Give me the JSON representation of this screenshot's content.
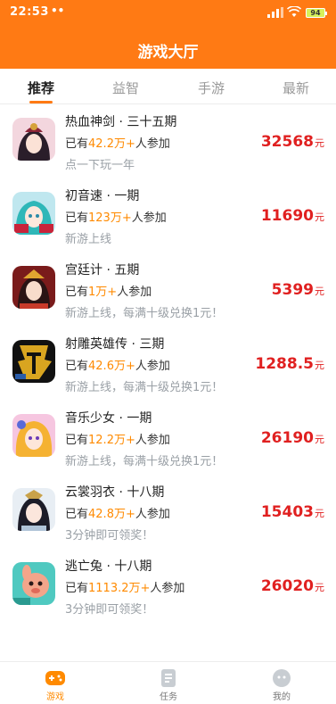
{
  "status_bar": {
    "time": "22:53",
    "dots": "••",
    "battery": "94"
  },
  "header": {
    "title": "游戏大厅"
  },
  "tabs": [
    {
      "label": "推荐",
      "active": true
    },
    {
      "label": "益智",
      "active": false
    },
    {
      "label": "手游",
      "active": false
    },
    {
      "label": "最新",
      "active": false
    }
  ],
  "games": [
    {
      "name": "热血神剑 · 三十五期",
      "players_prefix": "已有",
      "players_count": "42.2万+",
      "players_suffix": "人参加",
      "desc": "点一下玩一年",
      "prize": "32568",
      "prize_unit": "元",
      "icon": "game-icon-rexue"
    },
    {
      "name": "初音速 · 一期",
      "players_prefix": "已有",
      "players_count": "123万+",
      "players_suffix": "人参加",
      "desc": "新游上线",
      "prize": "11690",
      "prize_unit": "元",
      "icon": "game-icon-chuyin"
    },
    {
      "name": "宫廷计 · 五期",
      "players_prefix": "已有",
      "players_count": "1万+",
      "players_suffix": "人参加",
      "desc": "新游上线，每满十级兑换1元！",
      "prize": "5399",
      "prize_unit": "元",
      "icon": "game-icon-gongting"
    },
    {
      "name": "射雕英雄传 · 三期",
      "players_prefix": "已有",
      "players_count": "42.6万+",
      "players_suffix": "人参加",
      "desc": "新游上线，每满十级兑换1元！",
      "prize": "1288.5",
      "prize_unit": "元",
      "icon": "game-icon-shediao"
    },
    {
      "name": "音乐少女 · 一期",
      "players_prefix": "已有",
      "players_count": "12.2万+",
      "players_suffix": "人参加",
      "desc": "新游上线，每满十级兑换1元！",
      "prize": "26190",
      "prize_unit": "元",
      "icon": "game-icon-yinyue"
    },
    {
      "name": "云裳羽衣 · 十八期",
      "players_prefix": "已有",
      "players_count": "42.8万+",
      "players_suffix": "人参加",
      "desc": "3分钟即可领奖！",
      "prize": "15403",
      "prize_unit": "元",
      "icon": "game-icon-yunshang"
    },
    {
      "name": "逃亡兔 · 十八期",
      "players_prefix": "已有",
      "players_count": "1113.2万+",
      "players_suffix": "人参加",
      "desc": "3分钟即可领奖！",
      "prize": "26020",
      "prize_unit": "元",
      "icon": "game-icon-taowangtu"
    }
  ],
  "bottom_nav": [
    {
      "label": "游戏",
      "active": true,
      "icon": "gamepad-icon"
    },
    {
      "label": "任务",
      "active": false,
      "icon": "task-icon"
    },
    {
      "label": "我的",
      "active": false,
      "icon": "profile-icon"
    }
  ],
  "colors": {
    "brand": "#ff7a14",
    "prize": "#e02020",
    "players": "#ff8a00",
    "muted": "#9aa0a6"
  }
}
